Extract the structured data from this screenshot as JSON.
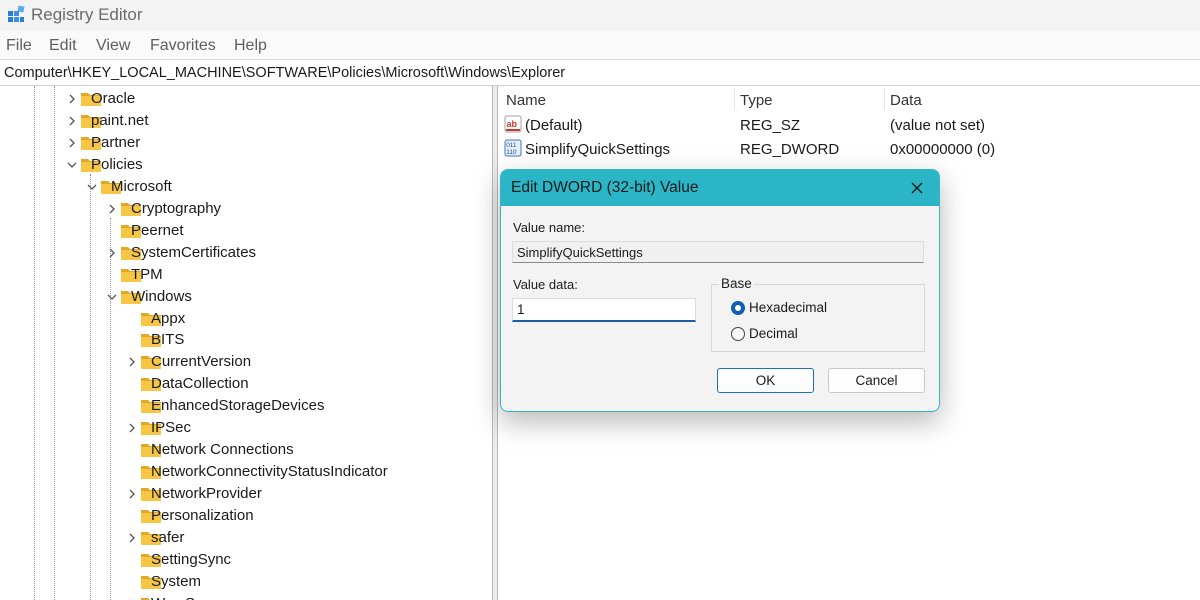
{
  "window": {
    "title": "Registry Editor"
  },
  "menu": [
    {
      "id": "file",
      "label": "File"
    },
    {
      "id": "edit",
      "label": "Edit"
    },
    {
      "id": "view",
      "label": "View"
    },
    {
      "id": "favorites",
      "label": "Favorites"
    },
    {
      "id": "help",
      "label": "Help"
    }
  ],
  "address": {
    "path": "Computer\\HKEY_LOCAL_MACHINE\\SOFTWARE\\Policies\\Microsoft\\Windows\\Explorer"
  },
  "tree": [
    {
      "label": "Oracle",
      "level": 0,
      "expander": "collapsed"
    },
    {
      "label": "paint.net",
      "level": 0,
      "expander": "collapsed"
    },
    {
      "label": "Partner",
      "level": 0,
      "expander": "collapsed"
    },
    {
      "label": "Policies",
      "level": 0,
      "expander": "expanded"
    },
    {
      "label": "Microsoft",
      "level": 1,
      "expander": "expanded"
    },
    {
      "label": "Cryptography",
      "level": 2,
      "expander": "collapsed"
    },
    {
      "label": "Peernet",
      "level": 2,
      "expander": "none"
    },
    {
      "label": "SystemCertificates",
      "level": 2,
      "expander": "collapsed"
    },
    {
      "label": "TPM",
      "level": 2,
      "expander": "none"
    },
    {
      "label": "Windows",
      "level": 2,
      "expander": "expanded"
    },
    {
      "label": "Appx",
      "level": 3,
      "expander": "none"
    },
    {
      "label": "BITS",
      "level": 3,
      "expander": "none"
    },
    {
      "label": "CurrentVersion",
      "level": 3,
      "expander": "collapsed"
    },
    {
      "label": "DataCollection",
      "level": 3,
      "expander": "none"
    },
    {
      "label": "EnhancedStorageDevices",
      "level": 3,
      "expander": "none"
    },
    {
      "label": "IPSec",
      "level": 3,
      "expander": "collapsed"
    },
    {
      "label": "Network Connections",
      "level": 3,
      "expander": "none"
    },
    {
      "label": "NetworkConnectivityStatusIndicator",
      "level": 3,
      "expander": "none"
    },
    {
      "label": "NetworkProvider",
      "level": 3,
      "expander": "collapsed"
    },
    {
      "label": "Personalization",
      "level": 3,
      "expander": "none"
    },
    {
      "label": "safer",
      "level": 3,
      "expander": "collapsed"
    },
    {
      "label": "SettingSync",
      "level": 3,
      "expander": "none"
    },
    {
      "label": "System",
      "level": 3,
      "expander": "none"
    },
    {
      "label": "WcmSvc",
      "level": 3,
      "expander": "collapsed"
    }
  ],
  "list": {
    "columns": [
      {
        "id": "name",
        "label": "Name"
      },
      {
        "id": "type",
        "label": "Type"
      },
      {
        "id": "data",
        "label": "Data"
      }
    ],
    "rows": [
      {
        "icon": "string-value-icon",
        "name": "(Default)",
        "type": "REG_SZ",
        "data": "(value not set)"
      },
      {
        "icon": "binary-value-icon",
        "name": "SimplifyQuickSettings",
        "type": "REG_DWORD",
        "data": "0x00000000 (0)"
      }
    ]
  },
  "dialog": {
    "title": "Edit DWORD (32-bit) Value",
    "value_name_label": "Value name:",
    "value_name": "SimplifyQuickSettings",
    "value_data_label": "Value data:",
    "value_data": "1",
    "base_label": "Base",
    "base_options": [
      {
        "label": "Hexadecimal",
        "selected": true
      },
      {
        "label": "Decimal",
        "selected": false
      }
    ],
    "ok_label": "OK",
    "cancel_label": "Cancel"
  },
  "colors": {
    "dialog_titlebar": "#2bb6c7",
    "folder": "#f6c644",
    "accent": "#0f5fb4"
  }
}
